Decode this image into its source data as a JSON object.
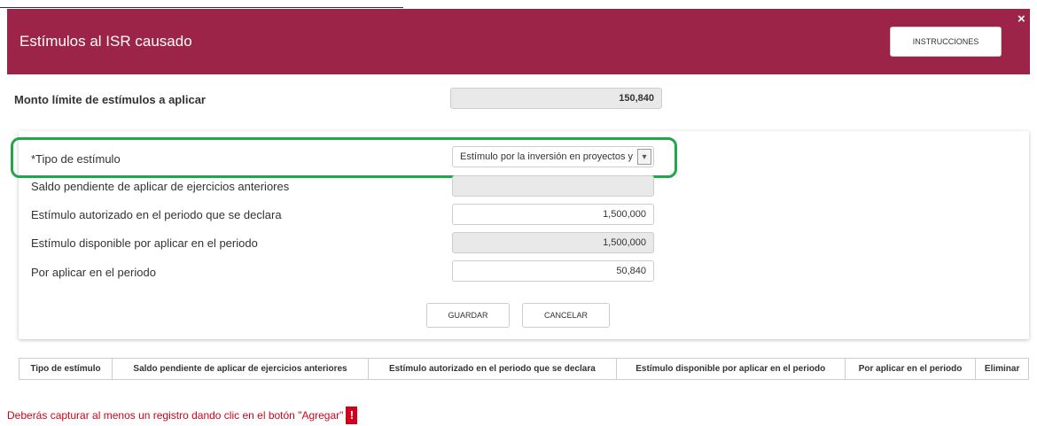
{
  "modal": {
    "title": "Estímulos al ISR causado",
    "instructions_label": "INSTRUCCIONES",
    "close_icon": "×"
  },
  "monto": {
    "label": "Monto límite de estímulos a aplicar",
    "value": "150,840"
  },
  "form": {
    "tipo_label": "*Tipo de estímulo",
    "tipo_value": "Estímulo por la inversión en proyectos y",
    "saldo_label": "Saldo pendiente de aplicar de ejercicios anteriores",
    "saldo_value": "",
    "autorizado_label": "Estímulo autorizado en el periodo que se declara",
    "autorizado_value": "1,500,000",
    "disponible_label": "Estímulo disponible por aplicar en el periodo",
    "disponible_value": "1,500,000",
    "por_aplicar_label": "Por aplicar en el periodo",
    "por_aplicar_value": "50,840",
    "save_label": "GUARDAR",
    "cancel_label": "CANCELAR"
  },
  "table": {
    "headers": [
      "Tipo de estímulo",
      "Saldo pendiente de aplicar de ejercicios anteriores",
      "Estímulo autorizado en el periodo que se declara",
      "Estímulo disponible por aplicar en el periodo",
      "Por aplicar en el periodo",
      "Eliminar"
    ]
  },
  "warning": {
    "text": "Deberás capturar al menos un registro dando clic en el botón \"Agregar\"",
    "badge": "!"
  },
  "colors": {
    "header_bg": "#9d2449",
    "highlight": "#22a64a",
    "warning": "#d0021b"
  }
}
